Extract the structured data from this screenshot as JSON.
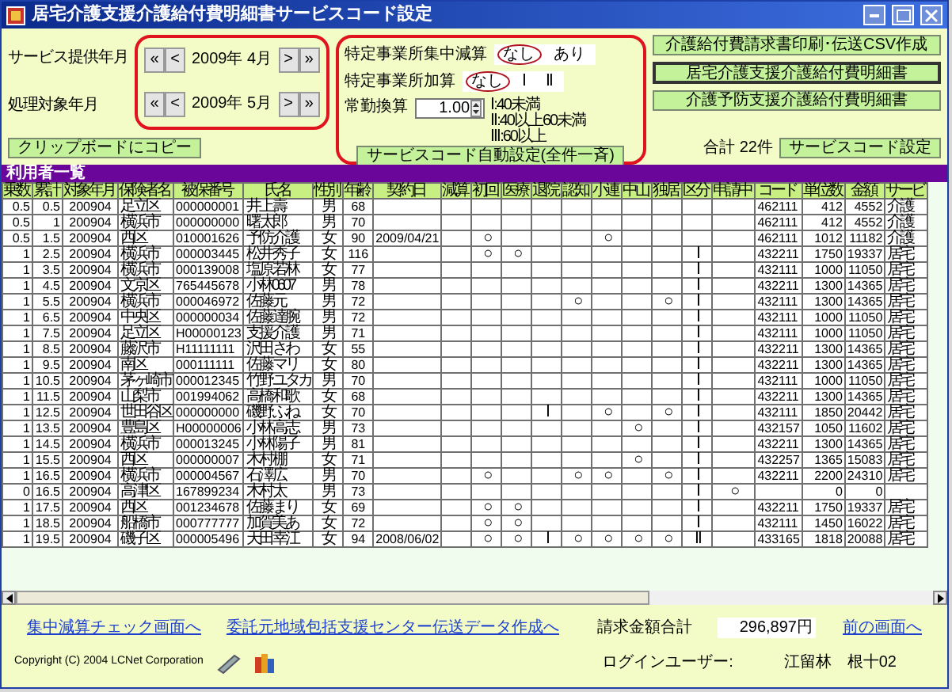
{
  "window": {
    "title": "居宅介護支援介護給付費明細書サービスコード設定"
  },
  "period": [
    {
      "label": "サービス提供年月",
      "value": "2009年 4月",
      "buttons": [
        "«",
        "<",
        ">",
        "»"
      ]
    },
    {
      "label": "処理対象年月",
      "value": "2009年 5月",
      "buttons": [
        "«",
        "<",
        ">",
        "»"
      ]
    }
  ],
  "clipboard_button": "クリップボードにコピー",
  "settings": {
    "reduction": {
      "label": "特定事業所集中減算",
      "options": [
        {
          "label": "なし",
          "selected": true
        },
        {
          "label": "あり",
          "selected": false
        }
      ]
    },
    "addition": {
      "label": "特定事業所加算",
      "options": [
        {
          "label": "なし",
          "selected": true
        },
        {
          "label": "Ⅰ",
          "selected": false
        },
        {
          "label": "Ⅱ",
          "selected": false
        }
      ]
    },
    "fte": {
      "label": "常勤換算",
      "value": "1.00",
      "legend": [
        "Ⅰ:40未満",
        "Ⅱ:40以上60未満",
        "Ⅲ:60以上"
      ]
    },
    "auto_button": "サービスコード自動設定(全件一斉)"
  },
  "actions": [
    {
      "label": "介護給付費請求書印刷･伝送CSV作成",
      "focused": false
    },
    {
      "label": "居宅介護支援介護給付費明細書",
      "focused": true
    },
    {
      "label": "介護予防支援介護給付費明細書",
      "focused": false
    }
  ],
  "total": "合計 22件",
  "service_code_button": "サービスコード設定",
  "list": {
    "title": "利用者一覧",
    "columns": [
      "乗数",
      "累計",
      "対象年月",
      "保険者名",
      "被保番号",
      "氏名",
      "性別",
      "年齢",
      "契約日",
      "減算",
      "初回",
      "医療",
      "退院",
      "認知",
      "小連",
      "中山",
      "独居",
      "区分",
      "申請中",
      "コード",
      "単位数",
      "金額",
      "サービ"
    ],
    "rows": [
      [
        "0.5",
        "0.5",
        "200904",
        "足立区",
        "000000001",
        "井上 壽",
        "男",
        "68",
        "",
        "",
        "",
        "",
        "",
        "",
        "",
        "",
        "",
        "",
        "",
        "462111",
        "412",
        "4552",
        "介護"
      ],
      [
        "0.5",
        "1",
        "200904",
        "横浜市",
        "000000000",
        "曙 太郎",
        "男",
        "70",
        "",
        "",
        "",
        "",
        "",
        "",
        "",
        "",
        "",
        "",
        "",
        "462111",
        "412",
        "4552",
        "介護"
      ],
      [
        "0.5",
        "1.5",
        "200904",
        "西区",
        "010001626",
        "予防 介護",
        "女",
        "90",
        "2009/04/21",
        "",
        "○",
        "",
        "",
        "",
        "○",
        "",
        "",
        "",
        "",
        "462111",
        "1012",
        "11182",
        "介護"
      ],
      [
        "1",
        "2.5",
        "200904",
        "横浜市",
        "000003445",
        "松井 秀子",
        "女",
        "116",
        "",
        "",
        "○",
        "○",
        "",
        "",
        "",
        "",
        "",
        "Ⅰ",
        "",
        "432211",
        "1750",
        "19337",
        "居宅"
      ],
      [
        "1",
        "3.5",
        "200904",
        "横浜市",
        "000139008",
        "塩原 若林",
        "女",
        "77",
        "",
        "",
        "",
        "",
        "",
        "",
        "",
        "",
        "",
        "Ⅰ",
        "",
        "432111",
        "1000",
        "11050",
        "居宅"
      ],
      [
        "1",
        "4.5",
        "200904",
        "文京区",
        "765445678",
        "小林0607",
        "男",
        "78",
        "",
        "",
        "",
        "",
        "",
        "",
        "",
        "",
        "",
        "Ⅰ",
        "",
        "432211",
        "1300",
        "14365",
        "居宅"
      ],
      [
        "1",
        "5.5",
        "200904",
        "横浜市",
        "000046972",
        "佐藤 元",
        "男",
        "72",
        "",
        "",
        "",
        "",
        "",
        "○",
        "",
        "",
        "○",
        "Ⅰ",
        "",
        "432111",
        "1300",
        "14365",
        "居宅"
      ],
      [
        "1",
        "6.5",
        "200904",
        "中央区",
        "000000034",
        "佐藤 達腕",
        "男",
        "72",
        "",
        "",
        "",
        "",
        "",
        "",
        "",
        "",
        "",
        "Ⅰ",
        "",
        "432111",
        "1000",
        "11050",
        "居宅"
      ],
      [
        "1",
        "7.5",
        "200904",
        "足立区",
        "H00000123",
        "支援 介護",
        "男",
        "71",
        "",
        "",
        "",
        "",
        "",
        "",
        "",
        "",
        "",
        "Ⅰ",
        "",
        "432111",
        "1000",
        "11050",
        "居宅"
      ],
      [
        "1",
        "8.5",
        "200904",
        "藤沢市",
        "H11111111",
        "沢田 さわ",
        "女",
        "55",
        "",
        "",
        "",
        "",
        "",
        "",
        "",
        "",
        "",
        "Ⅰ",
        "",
        "432211",
        "1300",
        "14365",
        "居宅"
      ],
      [
        "1",
        "9.5",
        "200904",
        "南区",
        "000111111",
        "佐藤 マリ",
        "女",
        "80",
        "",
        "",
        "",
        "",
        "",
        "",
        "",
        "",
        "",
        "Ⅰ",
        "",
        "432211",
        "1300",
        "14365",
        "居宅"
      ],
      [
        "1",
        "10.5",
        "200904",
        "茅ヶ崎市",
        "000012345",
        "竹野 ユタカ",
        "男",
        "70",
        "",
        "",
        "",
        "",
        "",
        "",
        "",
        "",
        "",
        "Ⅰ",
        "",
        "432111",
        "1000",
        "11050",
        "居宅"
      ],
      [
        "1",
        "11.5",
        "200904",
        "山梨市",
        "001994062",
        "高橋 和歌",
        "女",
        "68",
        "",
        "",
        "",
        "",
        "",
        "",
        "",
        "",
        "",
        "Ⅰ",
        "",
        "432211",
        "1300",
        "14365",
        "居宅"
      ],
      [
        "1",
        "12.5",
        "200904",
        "世田谷区",
        "000000000",
        "磯野 ふね",
        "女",
        "70",
        "",
        "",
        "",
        "",
        "Ⅰ",
        "",
        "○",
        "",
        "○",
        "Ⅰ",
        "",
        "432111",
        "1850",
        "20442",
        "居宅"
      ],
      [
        "1",
        "13.5",
        "200904",
        "豊島区",
        "H00000006",
        "小林 高志",
        "男",
        "73",
        "",
        "",
        "",
        "",
        "",
        "",
        "",
        "○",
        "",
        "Ⅰ",
        "",
        "432157",
        "1050",
        "11602",
        "居宅"
      ],
      [
        "1",
        "14.5",
        "200904",
        "横浜市",
        "000013245",
        "小林 陽子",
        "男",
        "81",
        "",
        "",
        "",
        "",
        "",
        "",
        "",
        "",
        "",
        "Ⅰ",
        "",
        "432211",
        "1300",
        "14365",
        "居宅"
      ],
      [
        "1",
        "15.5",
        "200904",
        "西区",
        "000000007",
        "木村 棚",
        "女",
        "71",
        "",
        "",
        "",
        "",
        "",
        "",
        "",
        "○",
        "",
        "Ⅰ",
        "",
        "432257",
        "1365",
        "15083",
        "居宅"
      ],
      [
        "1",
        "16.5",
        "200904",
        "横浜市",
        "000004567",
        "石澤 広",
        "男",
        "70",
        "",
        "",
        "○",
        "",
        "",
        "○",
        "○",
        "",
        "○",
        "Ⅰ",
        "",
        "432211",
        "2200",
        "24310",
        "居宅"
      ],
      [
        "0",
        "16.5",
        "200904",
        "高津区",
        "167899234",
        "木村 太",
        "男",
        "73",
        "",
        "",
        "",
        "",
        "",
        "",
        "",
        "",
        "",
        "Ⅰ",
        "○",
        "",
        "0",
        "0",
        ""
      ],
      [
        "1",
        "17.5",
        "200904",
        "西区",
        "001234678",
        "佐藤 まり",
        "女",
        "69",
        "",
        "",
        "○",
        "○",
        "",
        "",
        "",
        "",
        "",
        "Ⅰ",
        "",
        "432211",
        "1750",
        "19337",
        "居宅"
      ],
      [
        "1",
        "18.5",
        "200904",
        "船橋市",
        "000777777",
        "加賀美 あ",
        "女",
        "72",
        "",
        "",
        "○",
        "○",
        "",
        "",
        "",
        "",
        "",
        "Ⅰ",
        "",
        "432111",
        "1450",
        "16022",
        "居宅"
      ],
      [
        "1",
        "19.5",
        "200904",
        "磯子区",
        "000005496",
        "天田 幸江",
        "女",
        "94",
        "2008/06/02",
        "",
        "○",
        "○",
        "Ⅰ",
        "○",
        "○",
        "○",
        "○",
        "Ⅱ",
        "",
        "433165",
        "1818",
        "20088",
        "居宅"
      ]
    ]
  },
  "footer": {
    "links": [
      "集中減算チェック画面へ",
      "委託元地域包括支援センター伝送データ作成へ"
    ],
    "sum_label": "請求金額合計",
    "sum_value": "296,897円",
    "back_link": "前の画面へ",
    "copyright": "Copyright (C) 2004 LCNet Corporation",
    "login_label": "ログインユーザー:",
    "login_user": "江留林　根十02"
  }
}
